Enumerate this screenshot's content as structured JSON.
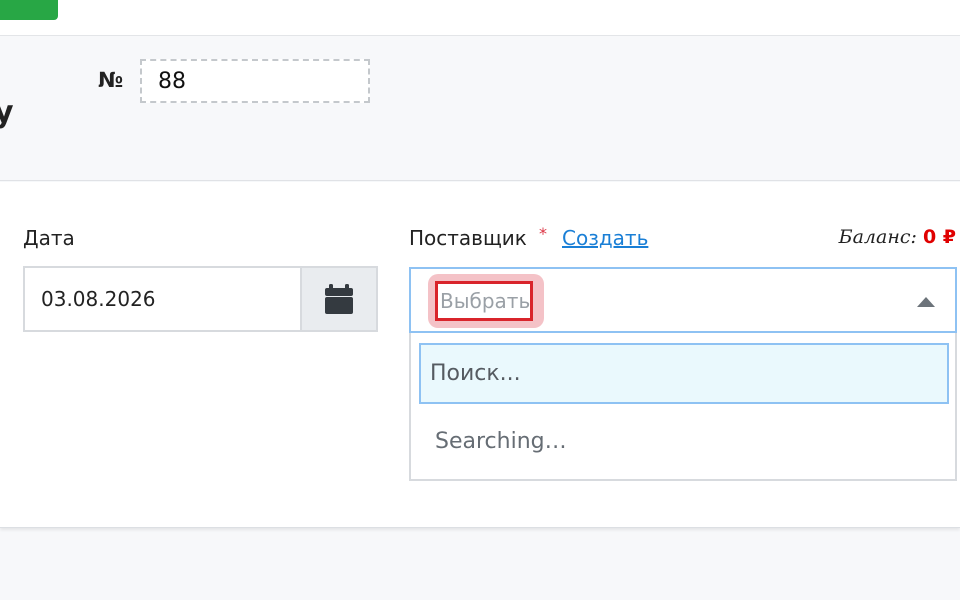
{
  "header": {
    "title_fragment": "у",
    "number_label": "№",
    "number_value": "88"
  },
  "form": {
    "date": {
      "label": "Дата",
      "value": "03.08.2026",
      "button_icon": "calendar-icon"
    },
    "supplier": {
      "label": "Поставщик",
      "required_mark": "*",
      "create_link": "Создать",
      "balance_label": "Баланс:",
      "balance_value": "0 ₽",
      "placeholder": "Выбрать",
      "arrow_icon": "caret-up-icon",
      "dropdown": {
        "search_placeholder": "Поиск...",
        "status": "Searching…"
      }
    }
  },
  "colors": {
    "accent": "#1a7fd6",
    "required": "#dc3545",
    "balance": "#e00000",
    "highlight": "#d9242b",
    "topbar_button": "#28a745"
  }
}
